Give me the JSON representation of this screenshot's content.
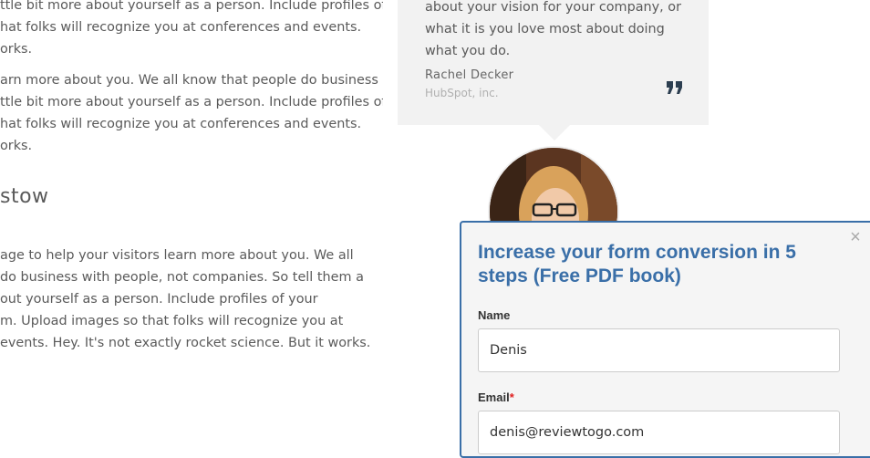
{
  "content": {
    "paragraphs": [
      [
        "ttle bit more about yourself as a person. Include profiles of",
        "hat folks will recognize you at conferences and events.",
        "orks."
      ],
      [
        "arn more about you. We all know that people do business",
        "ttle bit more about yourself as a person. Include profiles of",
        "hat folks will recognize you at conferences and events.",
        "orks."
      ]
    ],
    "heading": "stow",
    "last_paragraph": [
      "age to help your visitors learn more about you. We all",
      " do business with people, not companies. So tell them a",
      "out yourself as a person. Include profiles of your",
      "m. Upload images so that folks will recognize you at",
      "events. Hey. It's not exactly rocket science. But it works."
    ]
  },
  "testimonial": {
    "quote_lines": [
      "about your vision for your company, or",
      "what it is you love most about doing",
      "what you do."
    ],
    "author": "Rachel Decker",
    "company": "HubSpot, inc.",
    "quote_icon": "quote-icon",
    "bg_color": "#f2f2f2"
  },
  "popup": {
    "title": "Increase your form conversion in 5 steps (Free PDF book)",
    "close_label": "×",
    "name_label": "Name",
    "name_value": "Denis",
    "email_label": "Email",
    "email_required": "*",
    "email_value": "denis@reviewtogo.com",
    "accent_color": "#3a6fa8"
  }
}
